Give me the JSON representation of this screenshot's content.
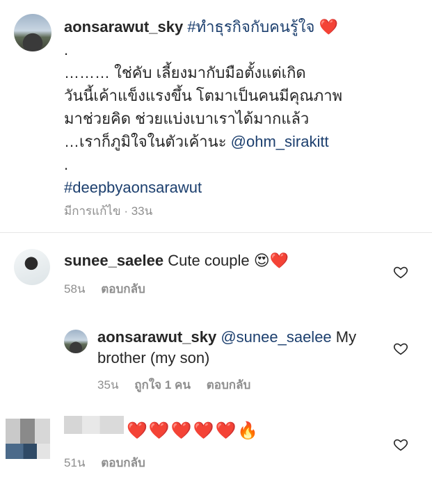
{
  "post": {
    "username": "aonsarawut_sky",
    "hashtag": "#ทำธุรกิจกับคนรู้ใจ",
    "heart": "❤️",
    "lines": [
      ".",
      "……… ใช่คับ เลี้ยงมากับมือตั้งแต่เกิด",
      "วันนี้เค้าแข็งแรงขึ้น โตมาเป็นคนมีคุณภาพ",
      "มาช่วยคิด ช่วยแบ่งเบาเราได้มากแล้ว",
      "…เราก็ภูมิใจในตัวเค้านะ",
      "."
    ],
    "mention": "@ohm_sirakitt",
    "hashtag2": "#deepbyaonsarawut",
    "edited_label": "มีการแก้ไข · 33น"
  },
  "comments": [
    {
      "username": "sunee_saelee",
      "text": "Cute couple",
      "emoji": "😍❤️",
      "time": "58น",
      "reply_label": "ตอบกลับ"
    },
    {
      "username": "aonsarawut_sky",
      "mention": "@sunee_saelee",
      "text_tail": " My",
      "text_line2": "brother (my son)",
      "time": "35น",
      "likes_label": "ถูกใจ 1 คน",
      "reply_label": "ตอบกลับ"
    },
    {
      "emoji": "❤️❤️❤️❤️❤️🔥",
      "time": "51น",
      "reply_label": "ตอบกลับ"
    }
  ],
  "colors": {
    "text": "#262626",
    "link": "#1c3f6e",
    "meta": "#8e8e8e",
    "heart": "#ed2a2a"
  }
}
